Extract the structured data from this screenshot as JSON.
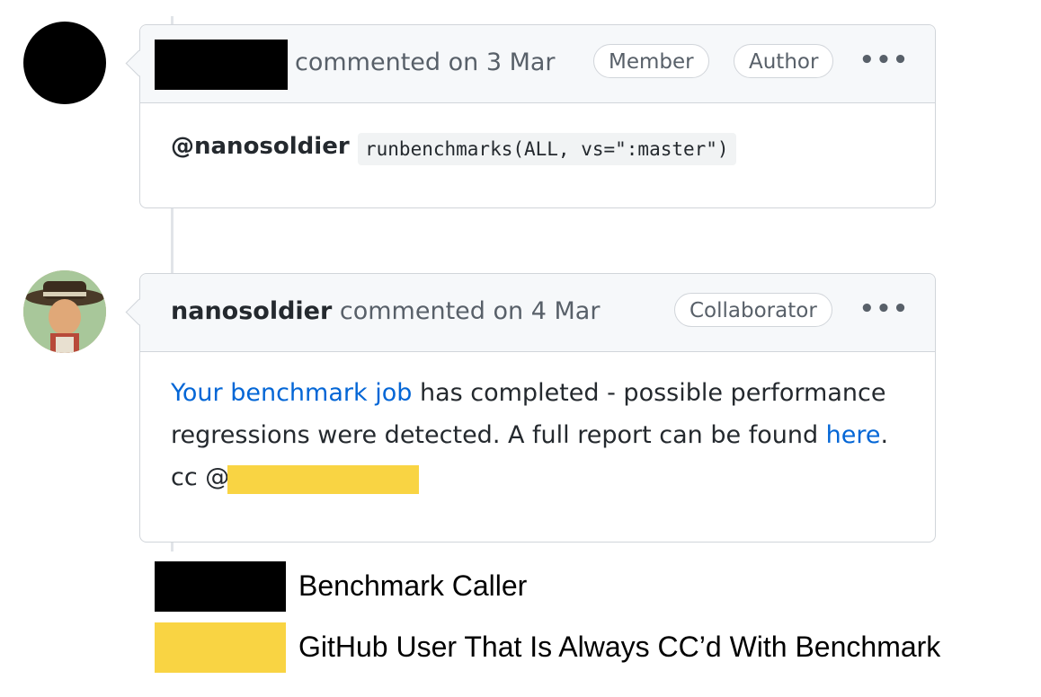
{
  "colors": {
    "redaction_black": "#000000",
    "redaction_yellow": "#f9d443",
    "link_blue": "#0366d6"
  },
  "comment1": {
    "meta": "commented on 3 Mar",
    "badges": [
      "Member",
      "Author"
    ],
    "menu": "•••",
    "mention": "@nanosoldier",
    "code": "runbenchmarks(ALL, vs=\":master\")"
  },
  "comment2": {
    "author": "nanosoldier",
    "meta": "commented on 4 Mar",
    "badge": "Collaborator",
    "menu": "•••",
    "body_link1": "Your benchmark job",
    "body_text1": " has completed - possible performance",
    "body_text2": "regressions were detected. A full report can be found ",
    "body_link2": "here",
    "body_period": ".",
    "cc_prefix": "cc @"
  },
  "legend": {
    "items": [
      {
        "label": "Benchmark Caller",
        "color": "#000000"
      },
      {
        "label": "GitHub User That Is Always CC’d With Benchmark",
        "color": "#f9d443"
      }
    ]
  }
}
